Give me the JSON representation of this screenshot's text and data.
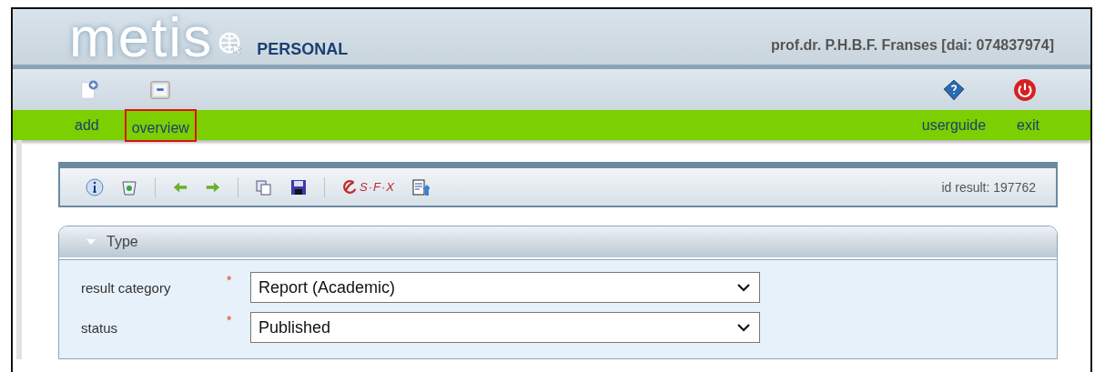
{
  "header": {
    "logo": "metis",
    "edition": "PERSONAL",
    "user": "prof.dr. P.H.B.F. Franses [dai: 074837974]"
  },
  "nav_left": [
    {
      "label": "add",
      "highlighted": false
    },
    {
      "label": "overview",
      "highlighted": true
    }
  ],
  "nav_right": [
    {
      "label": "userguide"
    },
    {
      "label": "exit"
    }
  ],
  "toolbar": {
    "sfx_text": "S·F·X",
    "id_text": "id result: 197762"
  },
  "section": {
    "title": "Type",
    "expanded": true,
    "fields": [
      {
        "label": "result category",
        "required_mark": "*",
        "value": "Report (Academic)"
      },
      {
        "label": "status",
        "required_mark": "*",
        "value": "Published"
      }
    ]
  }
}
